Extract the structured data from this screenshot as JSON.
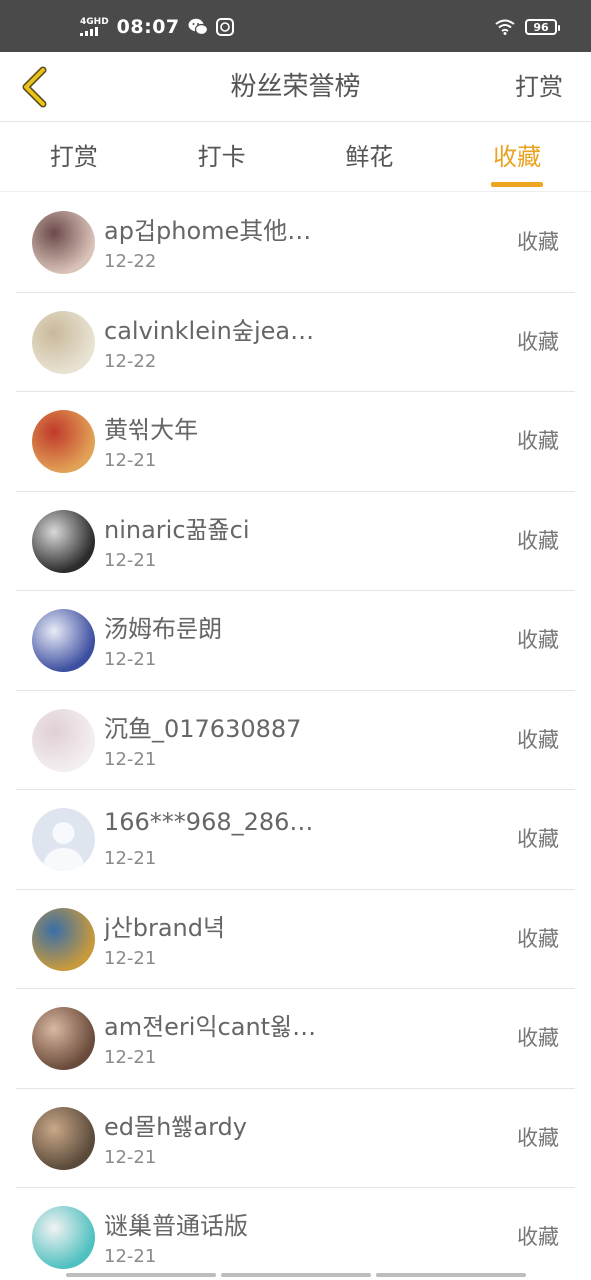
{
  "status_bar": {
    "network": "4G",
    "network_sub": "HD",
    "time": "08:07",
    "battery": "96"
  },
  "header": {
    "title": "粉丝荣誉榜",
    "right_action": "打赏"
  },
  "tabs": [
    {
      "label": "打赏",
      "active": false
    },
    {
      "label": "打卡",
      "active": false
    },
    {
      "label": "鲜花",
      "active": false
    },
    {
      "label": "收藏",
      "active": true
    }
  ],
  "list": [
    {
      "name": "ap겁phome其他…",
      "date": "12-22",
      "action": "收藏",
      "avatar_colors": [
        "#d9c2b8",
        "#6b4a4a"
      ]
    },
    {
      "name": "calvinklein숲jea…",
      "date": "12-22",
      "action": "收藏",
      "avatar_colors": [
        "#e8e2d2",
        "#c9b99a"
      ]
    },
    {
      "name": "黄쒺大年",
      "date": "12-21",
      "action": "收藏",
      "avatar_colors": [
        "#e2a256",
        "#c0392b"
      ]
    },
    {
      "name": "ninaric꿂죮ci",
      "date": "12-21",
      "action": "收藏",
      "avatar_colors": [
        "#2b2b2b",
        "#d9d9d9"
      ]
    },
    {
      "name": "汤姆布룬朗",
      "date": "12-21",
      "action": "收藏",
      "avatar_colors": [
        "#3d4fa0",
        "#e9ecf7"
      ]
    },
    {
      "name": "沉鱼_017630887",
      "date": "12-21",
      "action": "收藏",
      "avatar_colors": [
        "#f3eef0",
        "#e0cfd6"
      ]
    },
    {
      "name": "166***968_286…",
      "date": "12-21",
      "action": "收藏",
      "avatar_colors": [
        "#dfe5ef",
        "#c5cfe0"
      ]
    },
    {
      "name": "j산brand녁",
      "date": "12-21",
      "action": "收藏",
      "avatar_colors": [
        "#c89a3c",
        "#3a6ea8"
      ]
    },
    {
      "name": "am젼eri익cant욇…",
      "date": "12-21",
      "action": "收藏",
      "avatar_colors": [
        "#6a4a3a",
        "#d8b8a0"
      ]
    },
    {
      "name": "ed몰h쐟ardy",
      "date": "12-21",
      "action": "收藏",
      "avatar_colors": [
        "#5a4a3a",
        "#c9a888"
      ]
    },
    {
      "name": "谜巢普通话版",
      "date": "12-21",
      "action": "收藏",
      "avatar_colors": [
        "#4fc0c0",
        "#f2f2f2"
      ]
    }
  ],
  "colors": {
    "accent": "#eea520",
    "status_bar": "#4a4a4a",
    "back_icon": "#e0b30e"
  }
}
